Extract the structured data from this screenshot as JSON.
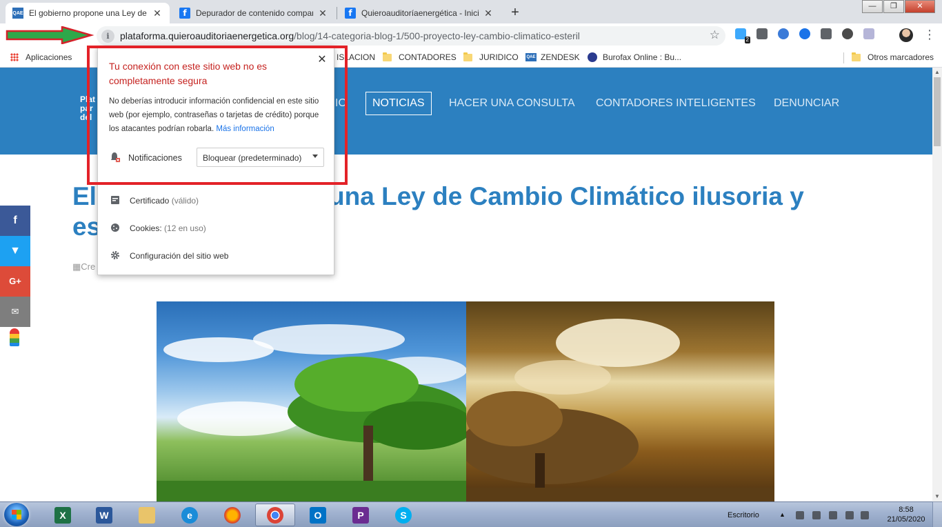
{
  "browser": {
    "tabs": [
      {
        "title": "El gobierno propone una Ley de",
        "favicon": "QAE",
        "active": true
      },
      {
        "title": "Depurador de contenido compar",
        "favicon": "f",
        "active": false
      },
      {
        "title": "Quieroauditoríaenergética - Inicio",
        "favicon": "f",
        "active": false
      }
    ],
    "new_tab": "+",
    "url_host": "plataforma.quieroauditoriaenergetica.org",
    "url_path": "/blog/14-categoria-blog-1/500-proyecto-ley-cambio-climatico-esteril",
    "extension_badge": "2",
    "window_controls": {
      "minimize": "—",
      "maximize": "❐",
      "close": "✕"
    }
  },
  "bookmarks": {
    "apps": "Aplicaciones",
    "items": [
      "ISLACION",
      "CONTADORES",
      "JURIDICO",
      "ZENDESK",
      "Burofax Online : Bu..."
    ],
    "other": "Otros marcadores"
  },
  "site": {
    "brand_lines": [
      "Plat",
      "par",
      "del"
    ],
    "nav": [
      "IO",
      "NOTICIAS",
      "HACER UNA CONSULTA",
      "CONTADORES INTELIGENTES",
      "DENUNCIAR"
    ],
    "title": "El gobierno propone una Ley de Cambio Climático ilusoria y estéril",
    "meta": "Cre"
  },
  "popup": {
    "heading": "Tu conexión con este sitio web no es completamente segura",
    "description": "No deberías introducir información confidencial en este sitio web (por ejemplo, contraseñas o tarjetas de crédito) porque los atacantes podrían robarla.",
    "more_info": "Más información",
    "notifications_label": "Notificaciones",
    "notifications_value": "Bloquear (predeterminado)",
    "certificate_label": "Certificado",
    "certificate_detail": "(válido)",
    "cookies_label": "Cookies:",
    "cookies_detail": "(12 en uso)",
    "settings_label": "Configuración del sitio web"
  },
  "taskbar": {
    "desktop_label": "Escritorio",
    "time": "8:58",
    "date": "21/05/2020"
  },
  "colors": {
    "header_blue": "#2c80c0",
    "warning_red": "#c5221f",
    "annotation_red": "#e32228",
    "annotation_green": "#2ea84a"
  }
}
